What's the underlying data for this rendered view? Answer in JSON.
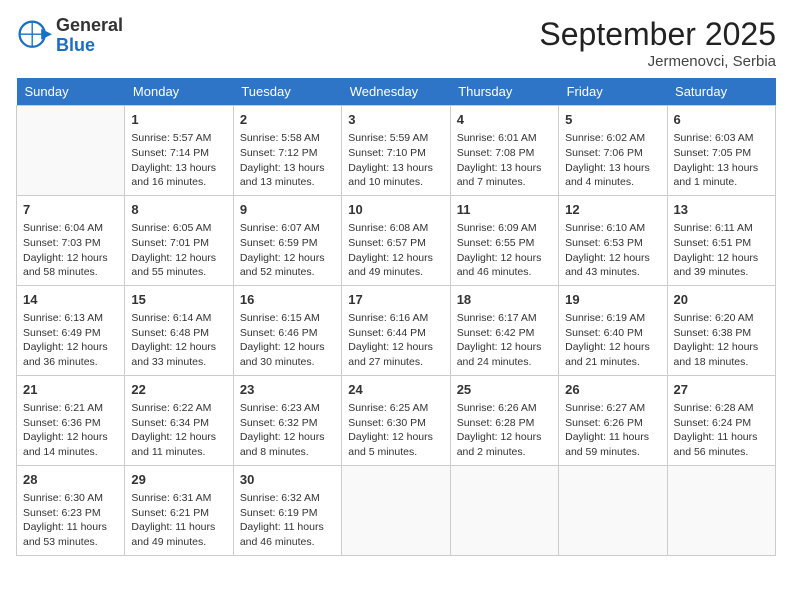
{
  "header": {
    "logo_general": "General",
    "logo_blue": "Blue",
    "month": "September 2025",
    "location": "Jermenovci, Serbia"
  },
  "days_of_week": [
    "Sunday",
    "Monday",
    "Tuesday",
    "Wednesday",
    "Thursday",
    "Friday",
    "Saturday"
  ],
  "weeks": [
    [
      {
        "day": "",
        "info": ""
      },
      {
        "day": "1",
        "info": "Sunrise: 5:57 AM\nSunset: 7:14 PM\nDaylight: 13 hours and 16 minutes."
      },
      {
        "day": "2",
        "info": "Sunrise: 5:58 AM\nSunset: 7:12 PM\nDaylight: 13 hours and 13 minutes."
      },
      {
        "day": "3",
        "info": "Sunrise: 5:59 AM\nSunset: 7:10 PM\nDaylight: 13 hours and 10 minutes."
      },
      {
        "day": "4",
        "info": "Sunrise: 6:01 AM\nSunset: 7:08 PM\nDaylight: 13 hours and 7 minutes."
      },
      {
        "day": "5",
        "info": "Sunrise: 6:02 AM\nSunset: 7:06 PM\nDaylight: 13 hours and 4 minutes."
      },
      {
        "day": "6",
        "info": "Sunrise: 6:03 AM\nSunset: 7:05 PM\nDaylight: 13 hours and 1 minute."
      }
    ],
    [
      {
        "day": "7",
        "info": "Sunrise: 6:04 AM\nSunset: 7:03 PM\nDaylight: 12 hours and 58 minutes."
      },
      {
        "day": "8",
        "info": "Sunrise: 6:05 AM\nSunset: 7:01 PM\nDaylight: 12 hours and 55 minutes."
      },
      {
        "day": "9",
        "info": "Sunrise: 6:07 AM\nSunset: 6:59 PM\nDaylight: 12 hours and 52 minutes."
      },
      {
        "day": "10",
        "info": "Sunrise: 6:08 AM\nSunset: 6:57 PM\nDaylight: 12 hours and 49 minutes."
      },
      {
        "day": "11",
        "info": "Sunrise: 6:09 AM\nSunset: 6:55 PM\nDaylight: 12 hours and 46 minutes."
      },
      {
        "day": "12",
        "info": "Sunrise: 6:10 AM\nSunset: 6:53 PM\nDaylight: 12 hours and 43 minutes."
      },
      {
        "day": "13",
        "info": "Sunrise: 6:11 AM\nSunset: 6:51 PM\nDaylight: 12 hours and 39 minutes."
      }
    ],
    [
      {
        "day": "14",
        "info": "Sunrise: 6:13 AM\nSunset: 6:49 PM\nDaylight: 12 hours and 36 minutes."
      },
      {
        "day": "15",
        "info": "Sunrise: 6:14 AM\nSunset: 6:48 PM\nDaylight: 12 hours and 33 minutes."
      },
      {
        "day": "16",
        "info": "Sunrise: 6:15 AM\nSunset: 6:46 PM\nDaylight: 12 hours and 30 minutes."
      },
      {
        "day": "17",
        "info": "Sunrise: 6:16 AM\nSunset: 6:44 PM\nDaylight: 12 hours and 27 minutes."
      },
      {
        "day": "18",
        "info": "Sunrise: 6:17 AM\nSunset: 6:42 PM\nDaylight: 12 hours and 24 minutes."
      },
      {
        "day": "19",
        "info": "Sunrise: 6:19 AM\nSunset: 6:40 PM\nDaylight: 12 hours and 21 minutes."
      },
      {
        "day": "20",
        "info": "Sunrise: 6:20 AM\nSunset: 6:38 PM\nDaylight: 12 hours and 18 minutes."
      }
    ],
    [
      {
        "day": "21",
        "info": "Sunrise: 6:21 AM\nSunset: 6:36 PM\nDaylight: 12 hours and 14 minutes."
      },
      {
        "day": "22",
        "info": "Sunrise: 6:22 AM\nSunset: 6:34 PM\nDaylight: 12 hours and 11 minutes."
      },
      {
        "day": "23",
        "info": "Sunrise: 6:23 AM\nSunset: 6:32 PM\nDaylight: 12 hours and 8 minutes."
      },
      {
        "day": "24",
        "info": "Sunrise: 6:25 AM\nSunset: 6:30 PM\nDaylight: 12 hours and 5 minutes."
      },
      {
        "day": "25",
        "info": "Sunrise: 6:26 AM\nSunset: 6:28 PM\nDaylight: 12 hours and 2 minutes."
      },
      {
        "day": "26",
        "info": "Sunrise: 6:27 AM\nSunset: 6:26 PM\nDaylight: 11 hours and 59 minutes."
      },
      {
        "day": "27",
        "info": "Sunrise: 6:28 AM\nSunset: 6:24 PM\nDaylight: 11 hours and 56 minutes."
      }
    ],
    [
      {
        "day": "28",
        "info": "Sunrise: 6:30 AM\nSunset: 6:23 PM\nDaylight: 11 hours and 53 minutes."
      },
      {
        "day": "29",
        "info": "Sunrise: 6:31 AM\nSunset: 6:21 PM\nDaylight: 11 hours and 49 minutes."
      },
      {
        "day": "30",
        "info": "Sunrise: 6:32 AM\nSunset: 6:19 PM\nDaylight: 11 hours and 46 minutes."
      },
      {
        "day": "",
        "info": ""
      },
      {
        "day": "",
        "info": ""
      },
      {
        "day": "",
        "info": ""
      },
      {
        "day": "",
        "info": ""
      }
    ]
  ]
}
